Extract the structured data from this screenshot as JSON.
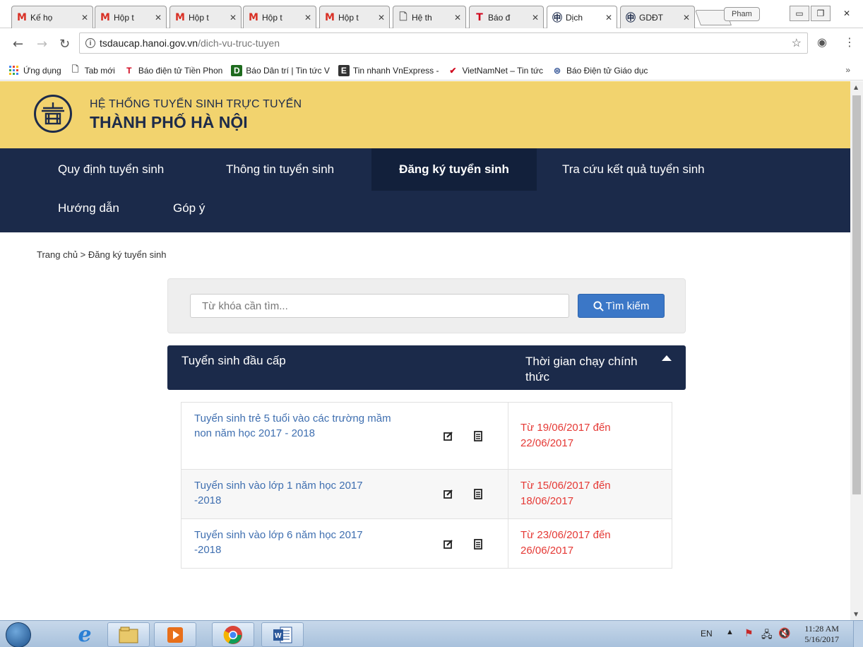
{
  "browser": {
    "tabs": [
      {
        "icon": "gmail-icon",
        "title": "Kế họ",
        "active": false
      },
      {
        "icon": "gmail-icon",
        "title": "Hộp t",
        "active": false
      },
      {
        "icon": "gmail-icon",
        "title": "Hộp t",
        "active": false
      },
      {
        "icon": "gmail-icon",
        "title": "Hộp t",
        "active": false
      },
      {
        "icon": "gmail-icon",
        "title": "Hộp t",
        "active": false
      },
      {
        "icon": "page-icon",
        "title": "Hệ th",
        "active": false
      },
      {
        "icon": "tienphong-icon",
        "title": "Báo đ",
        "active": false
      },
      {
        "icon": "emblem-icon",
        "title": "Dịch",
        "active": true
      },
      {
        "icon": "emblem-icon",
        "title": "GDĐT",
        "active": false
      }
    ],
    "user_badge": "Pham",
    "url_host": "tsdaucap.hanoi.gov.vn",
    "url_path": "/dich-vu-truc-tuyen",
    "bookmarks": [
      {
        "icon": "apps-icon",
        "label": "Ứng dụng"
      },
      {
        "icon": "page-icon",
        "label": "Tab mới"
      },
      {
        "icon": "tienphong-icon",
        "label": "Báo điện tử Tiền Phon"
      },
      {
        "icon": "dantri-icon",
        "label": "Báo Dân trí | Tin tức V"
      },
      {
        "icon": "vnexpress-icon",
        "label": "Tin nhanh VnExpress -"
      },
      {
        "icon": "vietnamnet-icon",
        "label": "VietNamNet – Tin tức"
      },
      {
        "icon": "giaoduc-icon",
        "label": "Báo Điện tử Giáo dục"
      }
    ],
    "bookmarks_more": "»"
  },
  "site": {
    "title_line1": "HỆ THỐNG TUYỂN SINH TRỰC TUYẾN",
    "title_line2": "THÀNH PHỐ HÀ NỘI",
    "nav": [
      {
        "label": "Quy định tuyển sinh",
        "active": false
      },
      {
        "label": "Thông tin tuyển sinh",
        "active": false
      },
      {
        "label": "Đăng ký tuyển sinh",
        "active": true
      },
      {
        "label": "Tra cứu kết quả tuyển sinh",
        "active": false
      },
      {
        "label": "Hướng dẫn",
        "active": false
      },
      {
        "label": "Góp ý",
        "active": false
      }
    ],
    "breadcrumb": "Trang chủ > Đăng ký tuyển sinh",
    "search": {
      "placeholder": "Từ khóa cần tìm...",
      "value": "",
      "button_label": "Tìm kiếm"
    },
    "table": {
      "col1": "Tuyển sinh đầu cấp",
      "col2": "Thời gian chạy chính thức",
      "rows": [
        {
          "title": "Tuyển sinh trẻ 5 tuổi vào các trường mầm non năm học 2017 - 2018",
          "time": "Từ 19/06/2017 đến 22/06/2017"
        },
        {
          "title": "Tuyển sinh vào lớp 1 năm học 2017 -2018",
          "time": "Từ 15/06/2017 đến 18/06/2017"
        },
        {
          "title": "Tuyển sinh vào lớp 6 năm học 2017 -2018",
          "time": "Từ 23/06/2017 đến 26/06/2017"
        }
      ]
    }
  },
  "taskbar": {
    "apps": [
      "ie-icon",
      "file-explorer-icon",
      "media-player-icon",
      "chrome-icon",
      "word-icon"
    ],
    "lang": "EN",
    "time": "11:28 AM",
    "date": "5/16/2017"
  },
  "colors": {
    "header_yellow": "#f2d36e",
    "nav_navy": "#1b2a4a",
    "link_blue": "#3f6fb0",
    "time_red": "#e53935",
    "button_blue": "#3b77c7"
  }
}
